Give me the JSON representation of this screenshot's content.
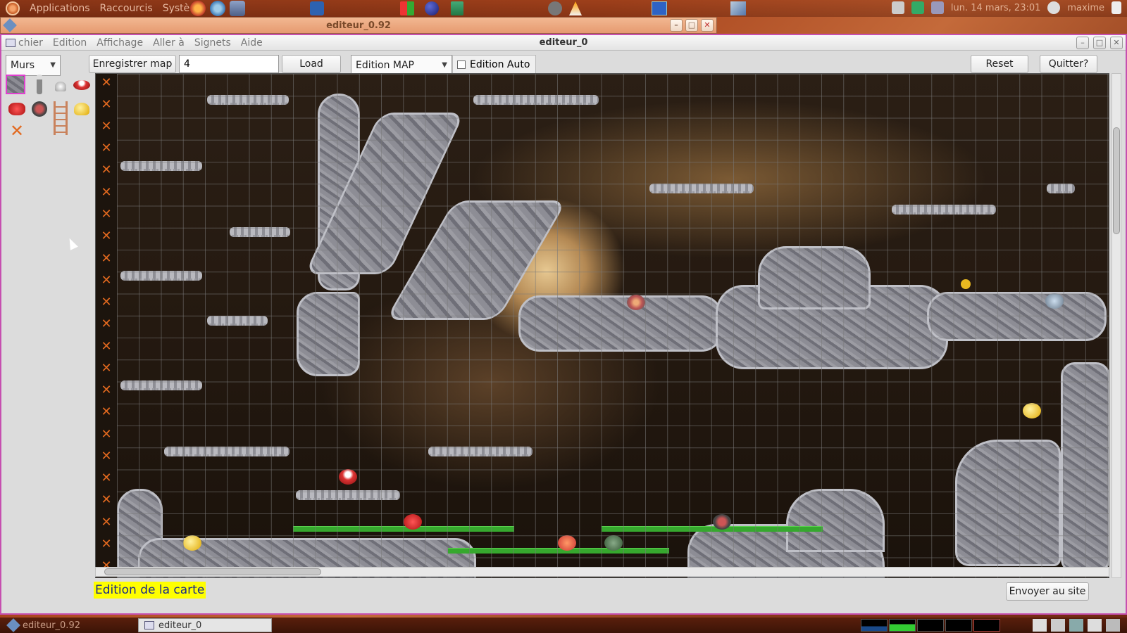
{
  "top_panel": {
    "menus": [
      "Applications",
      "Raccourcis",
      "Système"
    ],
    "clock": "lun. 14 mars, 23:01",
    "user": "maxime"
  },
  "back_window": {
    "title": "editeur_0.92"
  },
  "main_window": {
    "title": "editeur_0",
    "menubar": [
      "chier",
      "Edition",
      "Affichage",
      "Aller à",
      "Signets",
      "Aide"
    ]
  },
  "toolbar": {
    "layer_select": "Murs",
    "save_map": "Enregistrer map",
    "map_number": "4",
    "load": "Load",
    "mode_select": "Edition MAP",
    "auto_edit_label": "Edition Auto",
    "reset": "Reset",
    "quit": "Quitter?"
  },
  "palette": {
    "tiles": [
      "rock-tile",
      "player-tile",
      "lamp-tile",
      "red-saucer-tile",
      "red-crab-tile",
      "bomb-tile",
      "ladder-tile",
      "gold-tile",
      "erase-tile"
    ]
  },
  "status": {
    "label": "Edition de la carte"
  },
  "footer": {
    "send_button": "Envoyer au site"
  },
  "taskbar": {
    "inactive_task": "editeur_0.92",
    "active_task": "editeur_0"
  },
  "colors": {
    "status_bg": "#ffff00",
    "status_text": "#1a2a8a",
    "window_border": "#c64fb0",
    "delete_marker": "#e2691f",
    "platform_green": "#36a82e"
  }
}
